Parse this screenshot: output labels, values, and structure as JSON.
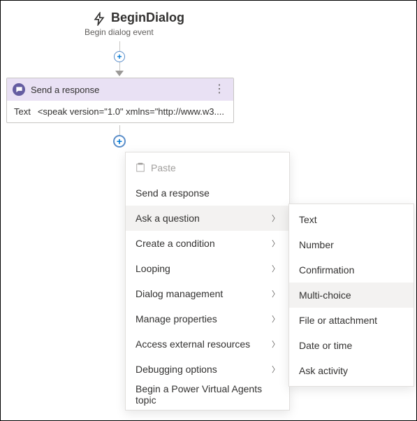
{
  "dialog": {
    "title": "BeginDialog",
    "subtitle": "Begin dialog event"
  },
  "node": {
    "title": "Send a response",
    "field_label": "Text",
    "field_value": "<speak version=\"1.0\" xmlns=\"http://www.w3...."
  },
  "menu": {
    "paste": "Paste",
    "send_response": "Send a response",
    "ask_question": "Ask a question",
    "create_condition": "Create a condition",
    "looping": "Looping",
    "dialog_management": "Dialog management",
    "manage_properties": "Manage properties",
    "access_external": "Access external resources",
    "debugging_options": "Debugging options",
    "begin_pva": "Begin a Power Virtual Agents topic"
  },
  "submenu": {
    "text": "Text",
    "number": "Number",
    "confirmation": "Confirmation",
    "multi_choice": "Multi-choice",
    "file_attach": "File or attachment",
    "date_time": "Date or time",
    "ask_activity": "Ask activity"
  }
}
